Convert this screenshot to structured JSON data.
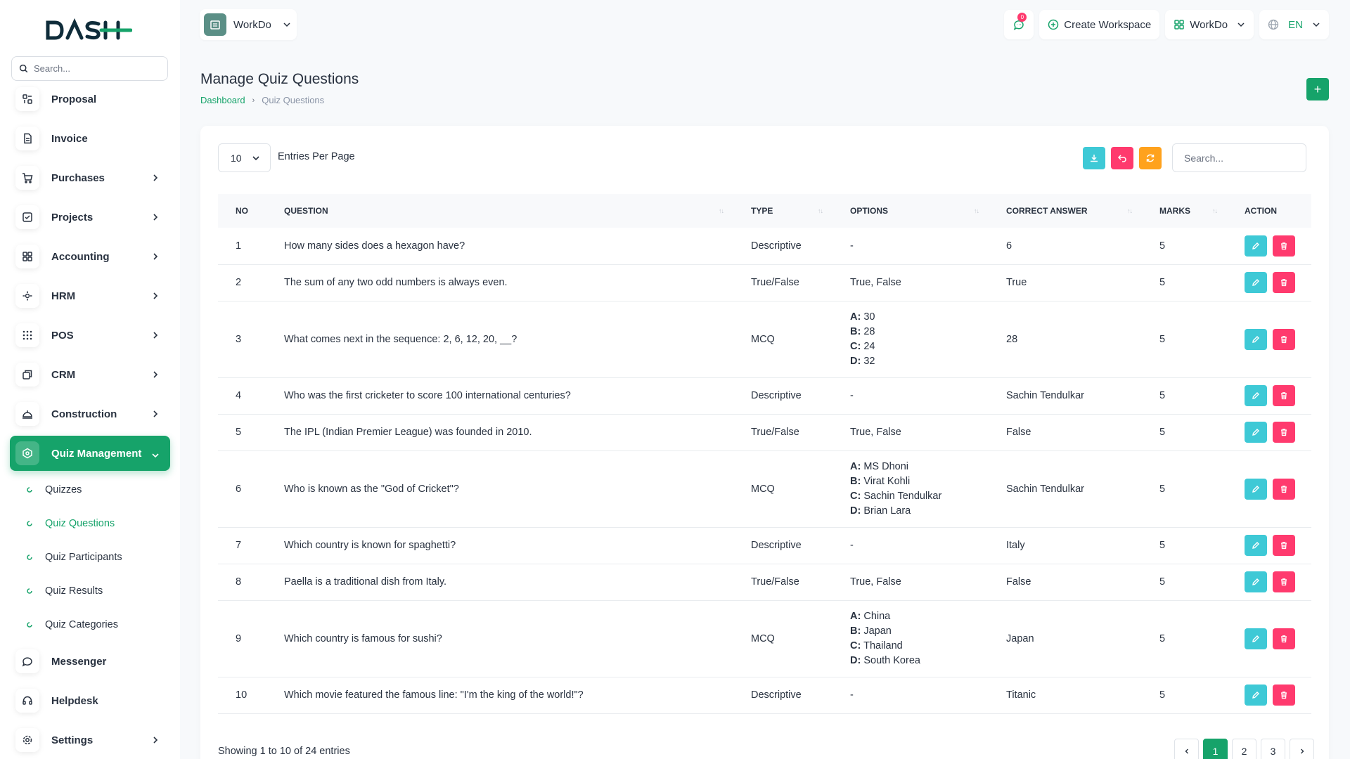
{
  "sidebar": {
    "logo_text": "DASH",
    "search_placeholder": "Search...",
    "items": [
      {
        "label": "Proposal",
        "icon": "proposal-icon",
        "has_chevron": false
      },
      {
        "label": "Invoice",
        "icon": "invoice-icon",
        "has_chevron": false
      },
      {
        "label": "Purchases",
        "icon": "cart-icon",
        "has_chevron": true
      },
      {
        "label": "Projects",
        "icon": "check-square-icon",
        "has_chevron": true
      },
      {
        "label": "Accounting",
        "icon": "grid-icon",
        "has_chevron": true
      },
      {
        "label": "HRM",
        "icon": "hrm-icon",
        "has_chevron": true
      },
      {
        "label": "POS",
        "icon": "dots-grid-icon",
        "has_chevron": true
      },
      {
        "label": "CRM",
        "icon": "crm-icon",
        "has_chevron": true
      },
      {
        "label": "Construction",
        "icon": "construction-icon",
        "has_chevron": true
      },
      {
        "label": "Quiz Management",
        "icon": "quiz-icon",
        "has_chevron": true,
        "active": true
      }
    ],
    "subitems": [
      {
        "label": "Quizzes"
      },
      {
        "label": "Quiz Questions",
        "active": true
      },
      {
        "label": "Quiz Participants"
      },
      {
        "label": "Quiz Results"
      },
      {
        "label": "Quiz Categories"
      }
    ],
    "bottom_items": [
      {
        "label": "Messenger",
        "icon": "messenger-icon",
        "has_chevron": false
      },
      {
        "label": "Helpdesk",
        "icon": "headset-icon",
        "has_chevron": false
      },
      {
        "label": "Settings",
        "icon": "gear-icon",
        "has_chevron": true
      }
    ]
  },
  "topbar": {
    "workspace_label": "WorkDo",
    "notification_count": "0",
    "create_workspace": "Create Workspace",
    "workspace_switch": "WorkDo",
    "language": "EN"
  },
  "page": {
    "title": "Manage Quiz Questions",
    "breadcrumb_home": "Dashboard",
    "breadcrumb_current": "Quiz Questions",
    "add_label": "+"
  },
  "table_controls": {
    "per_page": "10",
    "per_page_label": "Entries Per Page",
    "search_placeholder": "Search..."
  },
  "table": {
    "columns": [
      "NO",
      "QUESTION",
      "TYPE",
      "OPTIONS",
      "CORRECT ANSWER",
      "MARKS",
      "ACTION"
    ],
    "rows": [
      {
        "no": "1",
        "question": "How many sides does a hexagon have?",
        "type": "Descriptive",
        "options": "-",
        "answer": "6",
        "marks": "5"
      },
      {
        "no": "2",
        "question": "The sum of any two odd numbers is always even.",
        "type": "True/False",
        "options": "True, False",
        "answer": "True",
        "marks": "5"
      },
      {
        "no": "3",
        "question": "What comes next in the sequence: 2, 6, 12, 20, __?",
        "type": "MCQ",
        "options": [
          [
            "A:",
            "30"
          ],
          [
            "B:",
            "28"
          ],
          [
            "C:",
            "24"
          ],
          [
            "D:",
            "32"
          ]
        ],
        "answer": "28",
        "marks": "5"
      },
      {
        "no": "4",
        "question": "Who was the first cricketer to score 100 international centuries?",
        "type": "Descriptive",
        "options": "-",
        "answer": "Sachin Tendulkar",
        "marks": "5"
      },
      {
        "no": "5",
        "question": "The IPL (Indian Premier League) was founded in 2010.",
        "type": "True/False",
        "options": "True, False",
        "answer": "False",
        "marks": "5"
      },
      {
        "no": "6",
        "question": "Who is known as the \"God of Cricket\"?",
        "type": "MCQ",
        "options": [
          [
            "A:",
            "MS Dhoni"
          ],
          [
            "B:",
            "Virat Kohli"
          ],
          [
            "C:",
            "Sachin Tendulkar"
          ],
          [
            "D:",
            "Brian Lara"
          ]
        ],
        "answer": "Sachin Tendulkar",
        "marks": "5"
      },
      {
        "no": "7",
        "question": "Which country is known for spaghetti?",
        "type": "Descriptive",
        "options": "-",
        "answer": "Italy",
        "marks": "5"
      },
      {
        "no": "8",
        "question": "Paella is a traditional dish from Italy.",
        "type": "True/False",
        "options": "True, False",
        "answer": "False",
        "marks": "5"
      },
      {
        "no": "9",
        "question": "Which country is famous for sushi?",
        "type": "MCQ",
        "options": [
          [
            "A:",
            "China"
          ],
          [
            "B:",
            "Japan"
          ],
          [
            "C:",
            "Thailand"
          ],
          [
            "D:",
            "South Korea"
          ]
        ],
        "answer": "Japan",
        "marks": "5"
      },
      {
        "no": "10",
        "question": "Which movie featured the famous line: \"I'm the king of the world!\"?",
        "type": "Descriptive",
        "options": "-",
        "answer": "Titanic",
        "marks": "5"
      }
    ]
  },
  "footer": {
    "showing": "Showing 1 to 10 of 24 entries",
    "pages": [
      "1",
      "2",
      "3"
    ],
    "active_page": "1"
  },
  "colors": {
    "brand": "#16a36a",
    "info": "#3ec9d6",
    "danger": "#ff3a6e",
    "warning": "#ffa21d"
  }
}
